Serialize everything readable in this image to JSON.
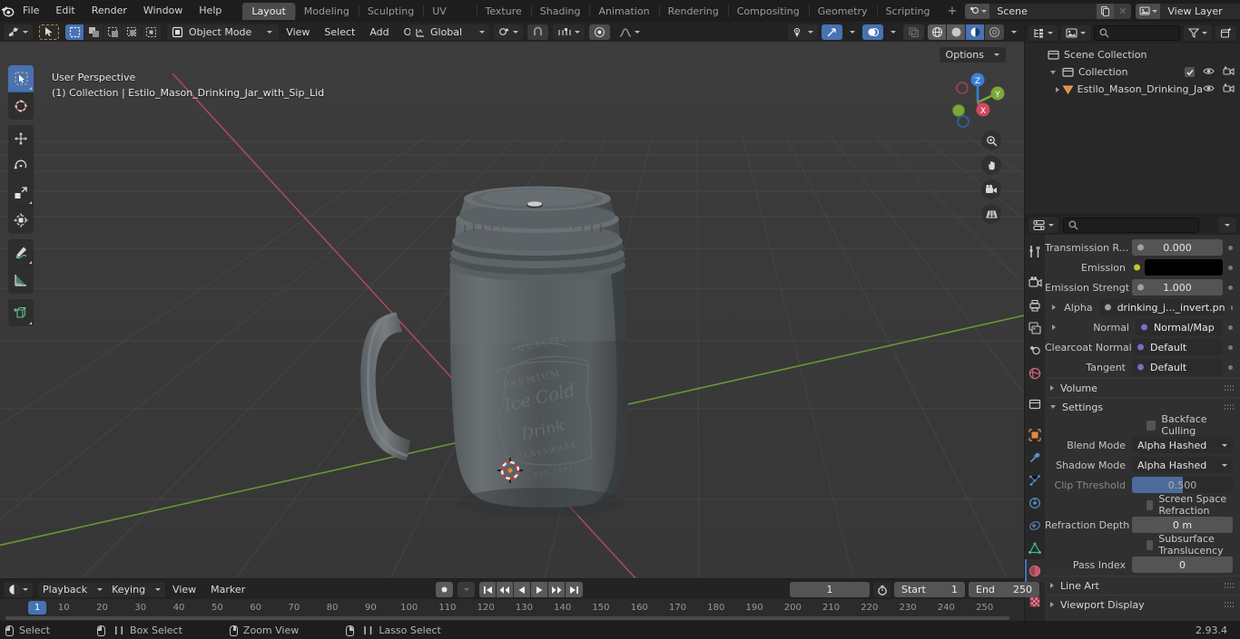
{
  "topbar": {
    "menus": [
      "File",
      "Edit",
      "Render",
      "Window",
      "Help"
    ],
    "workspaces": [
      {
        "label": "Layout",
        "active": true
      },
      {
        "label": "Modeling",
        "active": false
      },
      {
        "label": "Sculpting",
        "active": false
      },
      {
        "label": "UV Editing",
        "active": false
      },
      {
        "label": "Texture Paint",
        "active": false
      },
      {
        "label": "Shading",
        "active": false
      },
      {
        "label": "Animation",
        "active": false
      },
      {
        "label": "Rendering",
        "active": false
      },
      {
        "label": "Compositing",
        "active": false
      },
      {
        "label": "Geometry Nodes",
        "active": false
      },
      {
        "label": "Scripting",
        "active": false
      }
    ],
    "add_workspace_label": "+",
    "scene_name": "Scene",
    "view_layer_name": "View Layer"
  },
  "viewport": {
    "mode": "Object Mode",
    "menus": [
      "View",
      "Select",
      "Add",
      "Object"
    ],
    "transform_orientation": "Global",
    "options_label": "Options",
    "overlay_text_line1": "User Perspective",
    "overlay_text_line2": "(1) Collection | Estilo_Mason_Drinking_Jar_with_Sip_Lid",
    "gizmo_axes": [
      "X",
      "Y",
      "Z"
    ],
    "tools": [
      "tweak-select-tool",
      "cursor-tool",
      "move-tool",
      "rotate-tool",
      "scale-tool",
      "transform-tool",
      "annotate-tool",
      "measure-tool",
      "add-cube-tool"
    ],
    "nav_buttons": [
      "zoom-icon",
      "pan-icon",
      "camera-icon",
      "ortho-grid-icon"
    ]
  },
  "outliner": {
    "search_placeholder": "",
    "rows": [
      {
        "label": "Scene Collection",
        "depth": 0,
        "icon": "collection-icon",
        "expander": "none",
        "checkbox": false,
        "eye": false,
        "camera": false,
        "selected": false
      },
      {
        "label": "Collection",
        "depth": 1,
        "icon": "collection-icon",
        "expander": "down",
        "checkbox": true,
        "eye": true,
        "camera": true,
        "selected": false
      },
      {
        "label": "Estilo_Mason_Drinking_Ja",
        "depth": 2,
        "icon": "mesh-object-icon",
        "expander": "right",
        "checkbox": false,
        "eye": true,
        "camera": true,
        "selected": false
      }
    ]
  },
  "properties": {
    "search_placeholder": "",
    "tabs": [
      "tool-icon",
      "render-icon",
      "output-icon",
      "view-layer-icon",
      "scene-icon",
      "world-icon",
      "collection-icon",
      "object-icon",
      "modifier-icon",
      "particles-icon",
      "physics-icon",
      "constraints-icon",
      "data-icon",
      "material-icon",
      "texture-icon"
    ],
    "active_tab_index": 13,
    "fields": [
      {
        "kind": "value",
        "label": "Transmission R...",
        "value": "0.000",
        "socket_color": "#a1a1a1",
        "expander": false
      },
      {
        "kind": "color",
        "label": "Emission",
        "value": "",
        "socket_color": "#c7c729",
        "swatch": "#000000",
        "expander": false
      },
      {
        "kind": "value",
        "label": "Emission Strengt",
        "value": "1.000",
        "socket_color": "#a1a1a1",
        "expander": false
      },
      {
        "kind": "link",
        "label": "Alpha",
        "value": "drinking_j..._invert.pn",
        "socket_color": "#a1a1a1",
        "expander": true
      },
      {
        "kind": "link",
        "label": "Normal",
        "value": "Normal/Map",
        "socket_color": "#7171c6",
        "expander": true
      },
      {
        "kind": "link",
        "label": "Clearcoat Normal",
        "value": "Default",
        "socket_color": "#7171c6",
        "expander": false
      },
      {
        "kind": "link",
        "label": "Tangent",
        "value": "Default",
        "socket_color": "#7171c6",
        "expander": false
      }
    ],
    "panels": [
      {
        "label": "Volume",
        "open": false
      },
      {
        "label": "Settings",
        "open": true
      }
    ],
    "settings": {
      "backface_culling_label": "Backface Culling",
      "backface_culling_checked": false,
      "blend_mode_label": "Blend Mode",
      "blend_mode_value": "Alpha Hashed",
      "shadow_mode_label": "Shadow Mode",
      "shadow_mode_value": "Alpha Hashed",
      "clip_threshold_label": "Clip Threshold",
      "clip_threshold_value": "0.500",
      "clip_threshold_fill_pct": 50,
      "ssr_label": "Screen Space Refraction",
      "ssr_checked": false,
      "refraction_depth_label": "Refraction Depth",
      "refraction_depth_value": "0 m",
      "subsurface_label": "Subsurface Translucency",
      "subsurface_checked": false,
      "pass_index_label": "Pass Index",
      "pass_index_value": "0"
    },
    "bottom_panels": [
      {
        "label": "Line Art",
        "open": false
      },
      {
        "label": "Viewport Display",
        "open": false
      }
    ]
  },
  "timeline": {
    "menus": [
      "Playback",
      "Keying",
      "View",
      "Marker"
    ],
    "current_frame": "1",
    "start_label": "Start",
    "start_value": "1",
    "end_label": "End",
    "end_value": "250",
    "playhead_frame": "1",
    "ticks": [
      "10",
      "20",
      "30",
      "40",
      "50",
      "60",
      "70",
      "80",
      "90",
      "100",
      "110",
      "120",
      "130",
      "140",
      "150",
      "160",
      "170",
      "180",
      "190",
      "200",
      "210",
      "220",
      "230",
      "240",
      "250"
    ]
  },
  "status": {
    "hints": [
      {
        "label": "Select",
        "mouse": "lmb",
        "drag": false
      },
      {
        "label": "Box Select",
        "mouse": "lmb",
        "drag": true
      },
      {
        "label": "Zoom View",
        "mouse": "mmb",
        "drag": false
      },
      {
        "label": "Lasso Select",
        "mouse": "rmb",
        "drag": true
      }
    ],
    "version": "2.93.4"
  },
  "colors": {
    "accent_blue": "#4772b3",
    "axis_x": "#c7566a",
    "axis_y": "#7ba838",
    "axis_z": "#3b7fd4",
    "object_orange": "#e08a3c"
  }
}
